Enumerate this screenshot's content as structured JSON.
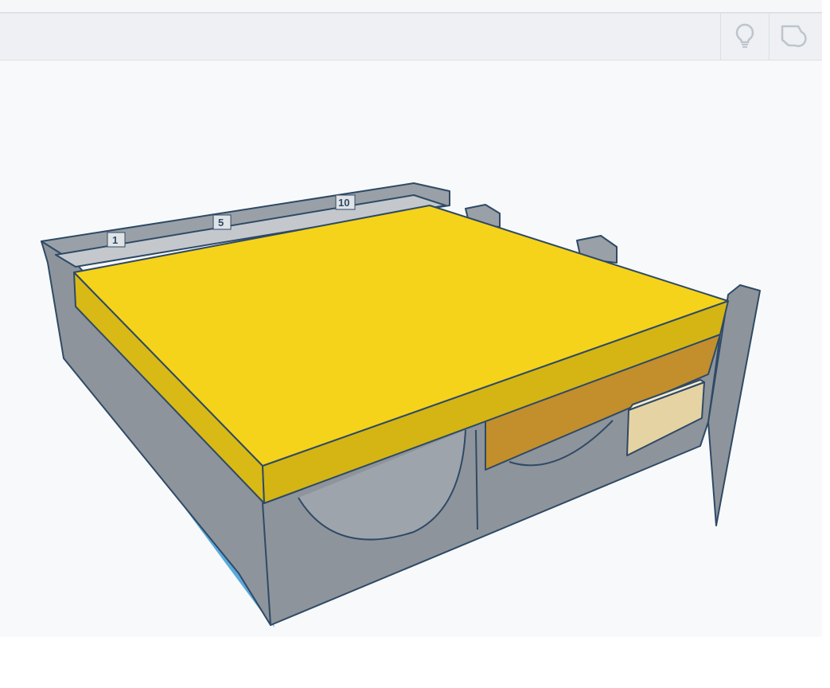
{
  "toolbar": {
    "buttons": [
      {
        "name": "lightbulb-icon",
        "label": "Tips"
      },
      {
        "name": "shape-notes-icon",
        "label": "Notes"
      }
    ]
  },
  "model": {
    "compartment_labels": [
      "1",
      "5",
      "10"
    ],
    "colors": {
      "lid": "#f5d31a",
      "lid_side": "#d9b915",
      "base": "#8e949b",
      "base_light": "#b8bdc3",
      "outline": "#2e4a66",
      "orange_block": "#c28f2c",
      "cream_block": "#e6d3a4",
      "grid": "#5aa9dd"
    }
  }
}
